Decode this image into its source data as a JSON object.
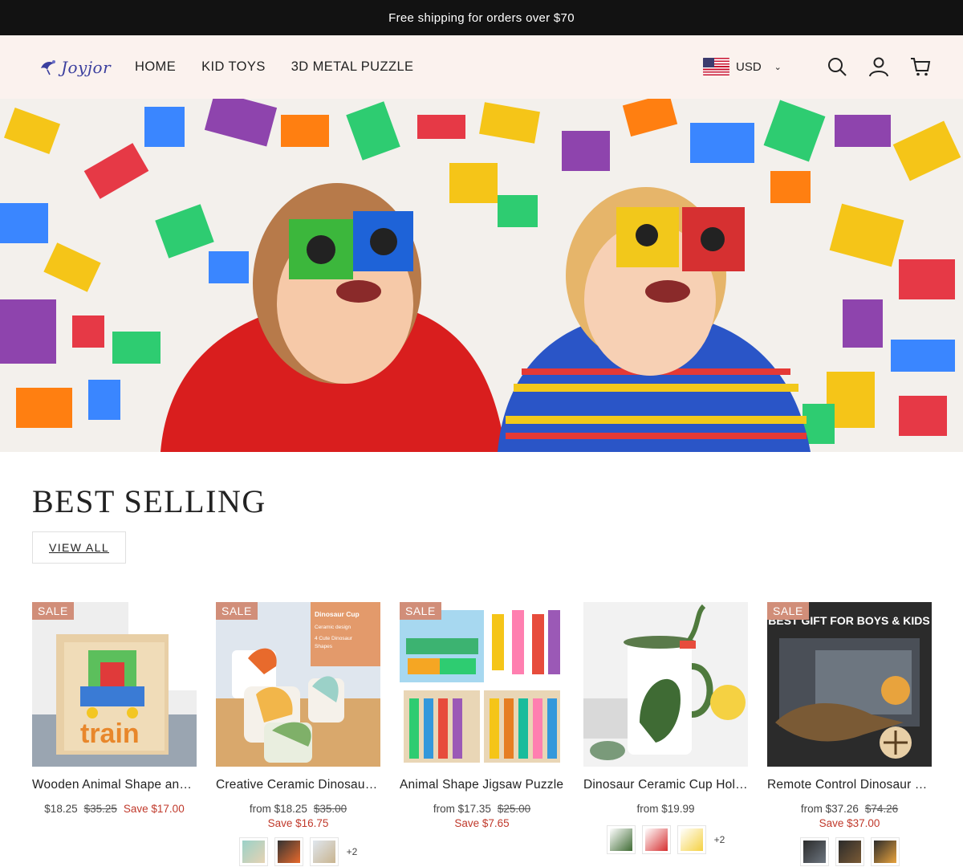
{
  "announcement": "Free shipping for orders over $70",
  "header": {
    "logo_text": "Joyjor",
    "nav": [
      "HOME",
      "KID TOYS",
      "3D METAL PUZZLE"
    ],
    "currency": "USD"
  },
  "section": {
    "title": "BEST SELLING",
    "view_all": "VIEW ALL"
  },
  "products": [
    {
      "badge": "SALE",
      "name": "Wooden Animal Shape and Letter Jigsaw Puzzle",
      "price": "$18.25",
      "compare": "$35.25",
      "save": "Save $17.00"
    },
    {
      "badge": "SALE",
      "name": "Creative Ceramic Dinosaur Mug",
      "price": "from $18.25",
      "compare": "$35.00",
      "save": "Save $16.75",
      "more": "+2"
    },
    {
      "badge": "SALE",
      "name": "Animal Shape Jigsaw Puzzle",
      "price": "from $17.35",
      "compare": "$25.00",
      "save": "Save $7.65"
    },
    {
      "name": "Dinosaur Ceramic Cup Holder",
      "price": "from $19.99",
      "more": "+2"
    },
    {
      "badge": "SALE",
      "name": "Remote Control Dinosaur Toy",
      "price": "from $37.26",
      "compare": "$74.26",
      "save": "Save $37.00"
    }
  ],
  "thumb_text": {
    "p2_box": [
      "Dinosaur Cup",
      "Ceramic design",
      "4 Cute Dinosaur",
      "Shapes"
    ],
    "p5_banner": "BEST GIFT FOR BOYS & KIDS"
  },
  "colors": {
    "announcement_bg": "#121212",
    "header_bg": "#fbf2ee",
    "sale_badge": "#d18e79",
    "save_text": "#c0392b",
    "logo": "#3b3f9e"
  }
}
